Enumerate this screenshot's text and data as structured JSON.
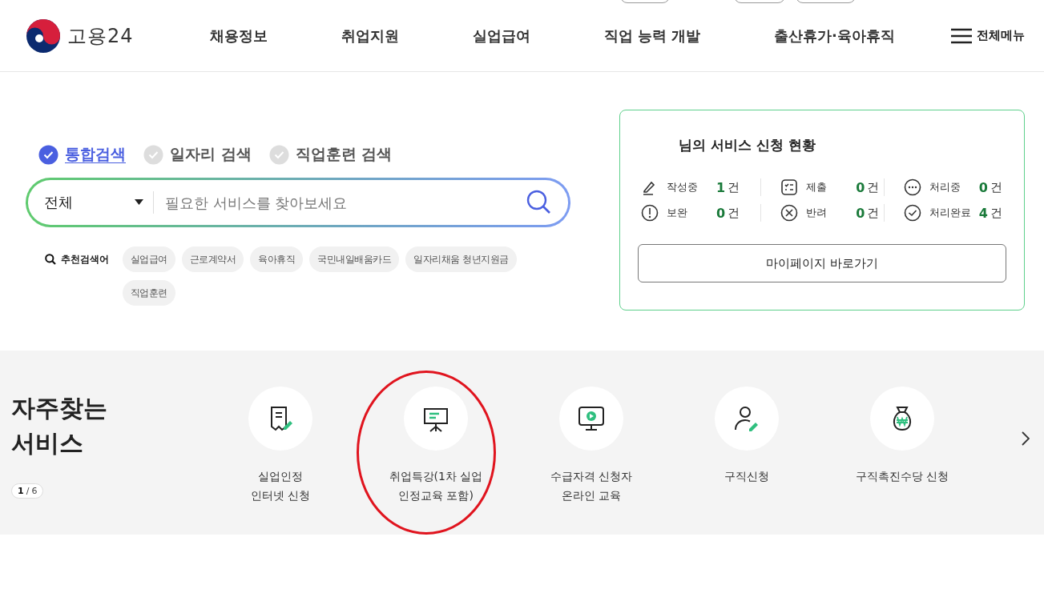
{
  "header": {
    "logo_text": "고용24",
    "nav": [
      "채용정보",
      "취업지원",
      "실업급여",
      "직업 능력 개발",
      "출산휴가·육아휴직"
    ],
    "menu_label": "전체메뉴"
  },
  "search": {
    "tabs": [
      {
        "label": "통합검색",
        "selected": true
      },
      {
        "label": "일자리 검색",
        "selected": false
      },
      {
        "label": "직업훈련 검색",
        "selected": false
      }
    ],
    "category": "전체",
    "placeholder": "필요한 서비스를 찾아보세요",
    "recommend_label": "추천검색어",
    "keywords": [
      "실업급여",
      "근로계약서",
      "육아휴직",
      "국민내일배움카드",
      "일자리채움 청년지원금",
      "직업훈련"
    ]
  },
  "status_card": {
    "title": "님의 서비스 신청 현황",
    "items": [
      {
        "kind": "pencil",
        "label": "작성중",
        "count": "1",
        "unit": "건"
      },
      {
        "kind": "checklist",
        "label": "제출",
        "count": "0",
        "unit": "건"
      },
      {
        "kind": "dots",
        "label": "처리중",
        "count": "0",
        "unit": "건"
      },
      {
        "kind": "exclaim",
        "label": "보완",
        "count": "0",
        "unit": "건"
      },
      {
        "kind": "cross",
        "label": "반려",
        "count": "0",
        "unit": "건"
      },
      {
        "kind": "check",
        "label": "처리완료",
        "count": "4",
        "unit": "건"
      }
    ],
    "button": "마이페이지 바로가기"
  },
  "favorites": {
    "title": "자주찾는\n서비스",
    "pager": {
      "current": "1",
      "separator": "/",
      "total": "6"
    },
    "items": [
      {
        "kind": "document",
        "label": "실업인정\n인터넷 신청"
      },
      {
        "kind": "presentation",
        "label": "취업특강(1차 실업\n인정교육 포함)",
        "circled": true
      },
      {
        "kind": "monitor",
        "label": "수급자격 신청자\n온라인 교육"
      },
      {
        "kind": "person",
        "label": "구직신청"
      },
      {
        "kind": "moneybag",
        "label": "구직촉진수당 신청"
      }
    ]
  }
}
